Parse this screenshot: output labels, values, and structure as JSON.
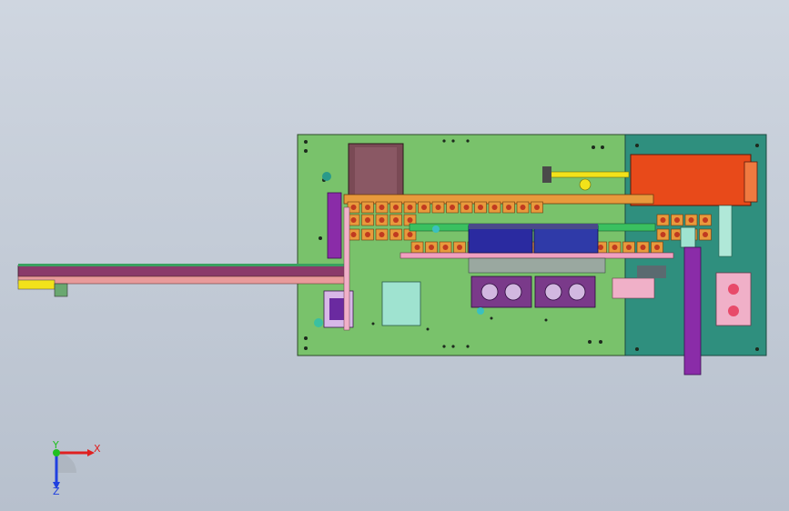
{
  "colors": {
    "background_top": "#cfd6e0",
    "background_bottom": "#b7c0cd",
    "base_plate": "#79c26b",
    "side_plate": "#2f8f7e",
    "conveyor_orange": "#e89a3c",
    "cover_orange": "#e84a1a",
    "track_magenta": "#8a3a6a",
    "cylinder_purple": "#8a2ca8",
    "motor_maroon": "#7a4a55",
    "slide_blue": "#2a2aa0",
    "mint_block": "#9fe3d0",
    "pink_block": "#f0a0c0",
    "yellow_rod": "#f2e21a",
    "axis_x": "#e02020",
    "axis_y": "#20c020",
    "axis_z": "#2040e0"
  },
  "triad": {
    "x_label": "X",
    "y_label": "Y",
    "z_label": "Z"
  }
}
